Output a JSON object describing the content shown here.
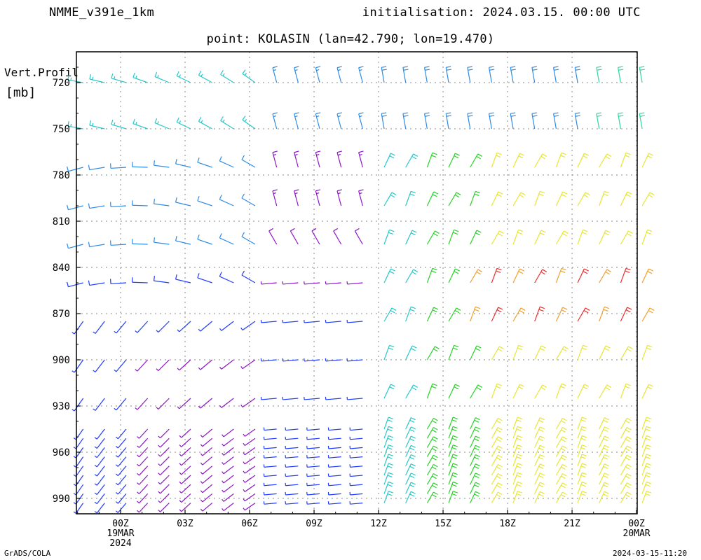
{
  "header": {
    "model": "NMME_v391e_1km",
    "initialisation": "initialisation: 2024.03.15. 00:00 UTC",
    "point": "point: KOLASIN (lan=42.790; lon=19.470)"
  },
  "footer": {
    "left": "GrADS/COLA",
    "right": "2024-03-15-11:20"
  },
  "chart_data": {
    "type": "wind-barb-profile",
    "ylabel_line1": "Vert.Profil",
    "ylabel_line2": "[mb]",
    "y_unit": "mb",
    "y_ticks": [
      720,
      750,
      780,
      810,
      840,
      870,
      900,
      930,
      960,
      990
    ],
    "y_range": [
      700,
      1000
    ],
    "y_inverted": true,
    "x_range_hours": [
      -2,
      24
    ],
    "x_ticks": [
      {
        "hour": 0,
        "label": "00Z",
        "sub1": "19MAR",
        "sub2": "2024"
      },
      {
        "hour": 3,
        "label": "03Z",
        "sub1": "",
        "sub2": ""
      },
      {
        "hour": 6,
        "label": "06Z",
        "sub1": "",
        "sub2": ""
      },
      {
        "hour": 9,
        "label": "09Z",
        "sub1": "",
        "sub2": ""
      },
      {
        "hour": 12,
        "label": "12Z",
        "sub1": "",
        "sub2": ""
      },
      {
        "hour": 15,
        "label": "15Z",
        "sub1": "",
        "sub2": ""
      },
      {
        "hour": 18,
        "label": "18Z",
        "sub1": "",
        "sub2": ""
      },
      {
        "hour": 21,
        "label": "21Z",
        "sub1": "",
        "sub2": ""
      },
      {
        "hour": 24,
        "label": "00Z",
        "sub1": "20MAR",
        "sub2": ""
      }
    ],
    "grid": true,
    "barb_levels": [
      720,
      750,
      775,
      800,
      825,
      850,
      875,
      900,
      925
    ],
    "barb_hours": [
      -2,
      -1,
      0,
      1,
      2,
      3,
      4,
      5,
      6,
      7,
      8,
      9,
      10,
      11,
      12,
      13,
      14,
      15,
      16,
      17,
      18,
      19,
      20,
      21,
      22,
      23,
      24
    ],
    "barb_colors": [
      "#1e3cff",
      "#2d8ce6",
      "#25c8c8",
      "#2ed9a0",
      "#28d228",
      "#9be632",
      "#e6e632",
      "#f0a02d",
      "#f02d2d",
      "#8c14c8"
    ]
  }
}
